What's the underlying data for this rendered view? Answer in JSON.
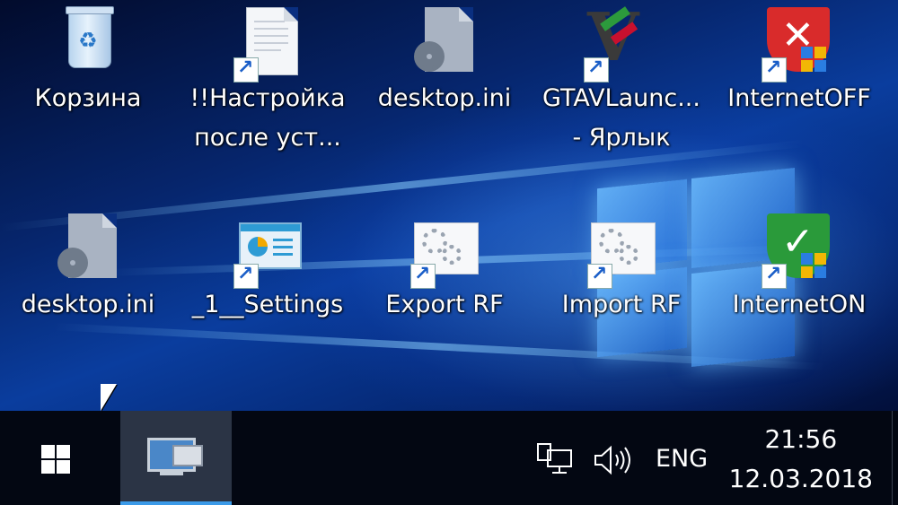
{
  "desktop": {
    "icons": [
      {
        "label": "Корзина",
        "type": "recycle-bin"
      },
      {
        "label_line1": "!!Настройка",
        "label_line2": "после уст...",
        "type": "document-shortcut"
      },
      {
        "label": "desktop.ini",
        "type": "ini-file"
      },
      {
        "label_line1": "GTAVLaunc...",
        "label_line2": "- Ярлык",
        "type": "gta-shortcut"
      },
      {
        "label": "InternetOFF",
        "type": "shield-red-shortcut"
      },
      {
        "label": "desktop.ini",
        "type": "ini-file"
      },
      {
        "label": "_1__Settings",
        "type": "settings-shortcut"
      },
      {
        "label": "Export RF",
        "type": "gears-shortcut"
      },
      {
        "label": "Import RF",
        "type": "gears-shortcut"
      },
      {
        "label": "InternetON",
        "type": "shield-green-shortcut"
      }
    ]
  },
  "taskbar": {
    "start_icon": "windows-logo-icon",
    "pinned_app_icon": "remote-desktop-icon",
    "network_icon": "network-icon",
    "volume_icon": "volume-icon",
    "language": "ENG",
    "time": "21:56",
    "date": "12.03.2018"
  },
  "colors": {
    "taskbar": "#030712",
    "active_underline": "#3b9ae8",
    "shield_red": "#d92b2b",
    "shield_green": "#2a9a3a"
  }
}
